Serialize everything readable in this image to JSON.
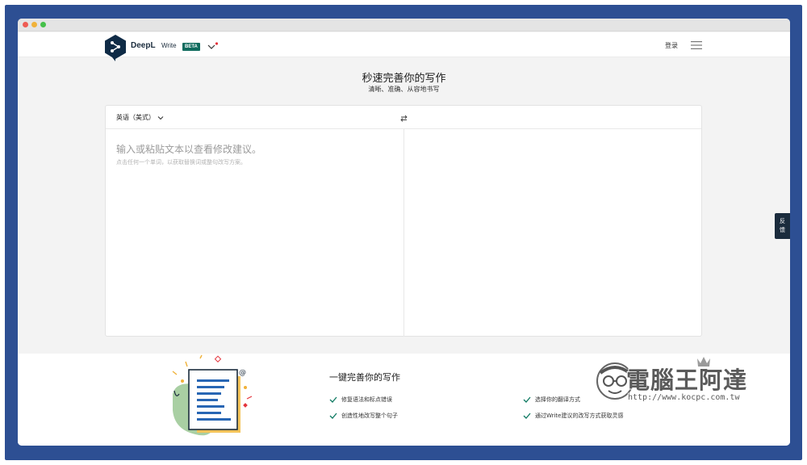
{
  "header": {
    "brand": "DeepL",
    "brand_sub": "Write",
    "badge": "BETA",
    "login": "登录"
  },
  "hero": {
    "title": "秒速完善你的写作",
    "subtitle": "清晰、准确、从容地书写"
  },
  "editor": {
    "language": "英语（美式）",
    "placeholder": "输入或粘贴文本以查看修改建议。",
    "hint": "点击任何一个单词，以获取替换词或整句改写方案。"
  },
  "feedback": [
    "反",
    "馈"
  ],
  "features": {
    "title": "一键完善你的写作",
    "items": [
      "修复语法和标点错误",
      "选择你的翻译方式",
      "创造性地改写整个句子",
      "通过Write建议的改写方式获取灵感"
    ]
  },
  "watermark": {
    "text": "電腦王阿達",
    "url": "http://www.kocpc.com.tw"
  },
  "colors": {
    "brand_dark": "#0f2b46",
    "badge": "#0f6b5e",
    "check": "#0f7a62",
    "frame": "#2d4f93"
  }
}
